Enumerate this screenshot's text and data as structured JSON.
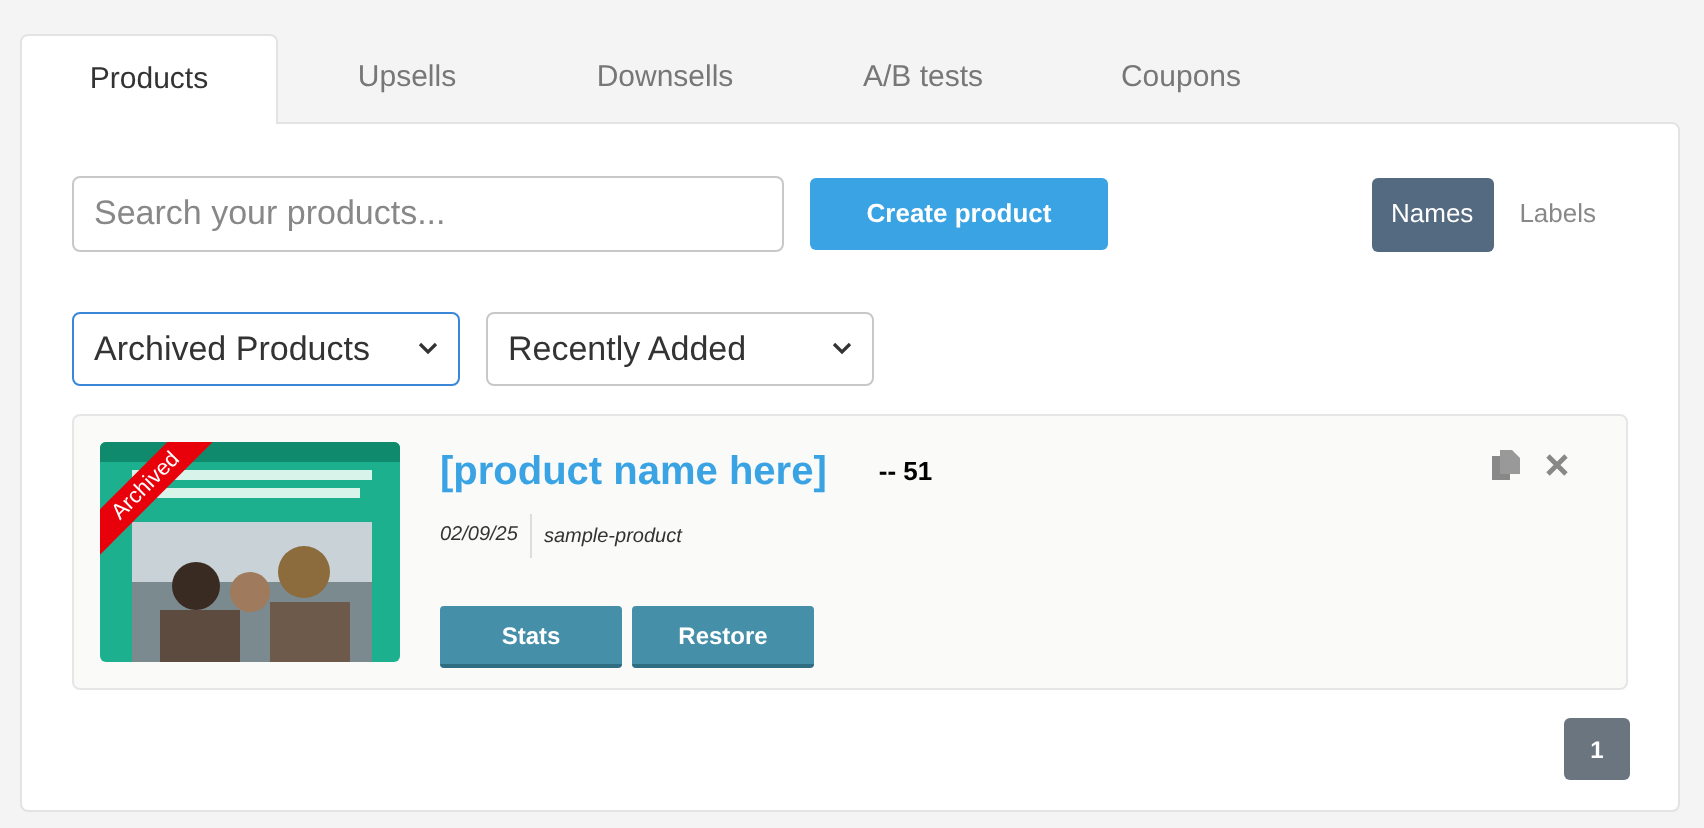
{
  "tabs": [
    {
      "label": "Products",
      "selected": true
    },
    {
      "label": "Upsells",
      "selected": false
    },
    {
      "label": "Downsells",
      "selected": false
    },
    {
      "label": "A/B tests",
      "selected": false
    },
    {
      "label": "Coupons",
      "selected": false
    }
  ],
  "search": {
    "placeholder": "Search your products..."
  },
  "create_button": "Create product",
  "view_toggle": [
    {
      "label": "Names",
      "selected": true
    },
    {
      "label": "Labels",
      "selected": false
    }
  ],
  "filters": [
    {
      "value": "Archived Products",
      "focused": true
    },
    {
      "value": "Recently Added",
      "focused": false
    }
  ],
  "products": [
    {
      "ribbon": "Archived",
      "name": "[product name here]",
      "count": "-- 51",
      "date": "02/09/25",
      "slug": "sample-product",
      "buttons": [
        "Stats",
        "Restore"
      ]
    }
  ],
  "pagination": [
    {
      "label": "1",
      "selected": true
    }
  ]
}
